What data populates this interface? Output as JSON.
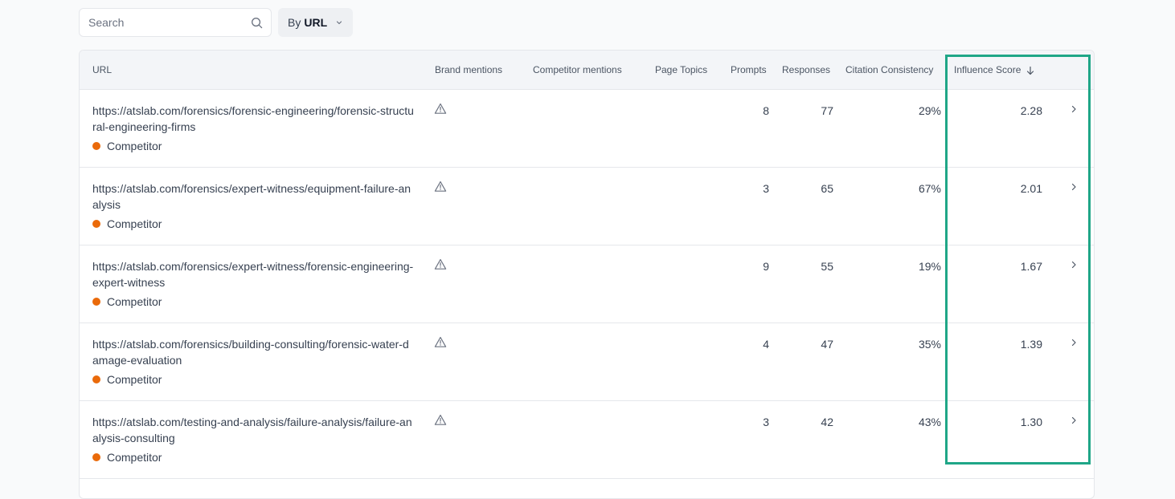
{
  "search": {
    "placeholder": "Search",
    "value": ""
  },
  "grouping": {
    "prefix": "By",
    "value": "URL"
  },
  "columns": {
    "url": "URL",
    "brand_mentions": "Brand mentions",
    "competitor_mentions": "Competitor mentions",
    "page_topics": "Page Topics",
    "prompts": "Prompts",
    "responses": "Responses",
    "citation_consistency": "Citation Consistency",
    "influence_score": "Influence Score"
  },
  "rows": [
    {
      "url": "https://atslab.com/forensics/forensic-engineering/forensic-structural-engineering-firms",
      "tag": "Competitor",
      "prompts": "8",
      "responses": "77",
      "citation_consistency": "29%",
      "influence_score": "2.28"
    },
    {
      "url": "https://atslab.com/forensics/expert-witness/equipment-failure-analysis",
      "tag": "Competitor",
      "prompts": "3",
      "responses": "65",
      "citation_consistency": "67%",
      "influence_score": "2.01"
    },
    {
      "url": "https://atslab.com/forensics/expert-witness/forensic-engineering-expert-witness",
      "tag": "Competitor",
      "prompts": "9",
      "responses": "55",
      "citation_consistency": "19%",
      "influence_score": "1.67"
    },
    {
      "url": "https://atslab.com/forensics/building-consulting/forensic-water-damage-evaluation",
      "tag": "Competitor",
      "prompts": "4",
      "responses": "47",
      "citation_consistency": "35%",
      "influence_score": "1.39"
    },
    {
      "url": "https://atslab.com/testing-and-analysis/failure-analysis/failure-analysis-consulting",
      "tag": "Competitor",
      "prompts": "3",
      "responses": "42",
      "citation_consistency": "43%",
      "influence_score": "1.30"
    }
  ],
  "colors": {
    "tag_competitor": "#ea6a0a",
    "highlight": "#1fa687"
  },
  "icons": {
    "search": "search-icon",
    "dropdown": "chevron-down-icon",
    "sort": "arrow-down-icon",
    "warning": "warning-icon",
    "row": "chevron-right-icon"
  }
}
